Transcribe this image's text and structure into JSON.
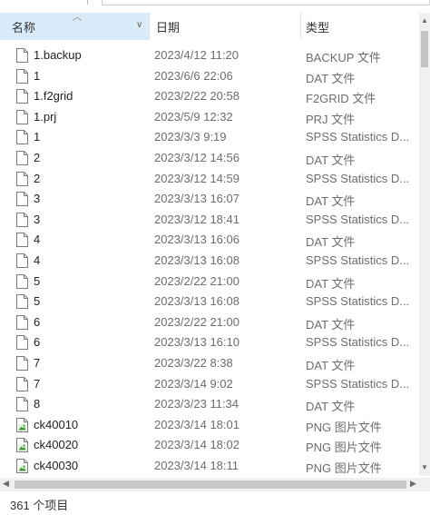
{
  "columns": {
    "name": "名称",
    "date": "日期",
    "type": "类型"
  },
  "sort": {
    "column": "name",
    "direction": "ascending"
  },
  "rows": [
    {
      "name": "1.backup",
      "date": "2023/4/12 11:20",
      "type": "BACKUP 文件",
      "icon": "generic-file-icon"
    },
    {
      "name": "1",
      "date": "2023/6/6 22:06",
      "type": "DAT 文件",
      "icon": "generic-file-icon"
    },
    {
      "name": "1.f2grid",
      "date": "2023/2/22 20:58",
      "type": "F2GRID 文件",
      "icon": "generic-file-icon"
    },
    {
      "name": "1.prj",
      "date": "2023/5/9 12:32",
      "type": "PRJ 文件",
      "icon": "generic-file-icon"
    },
    {
      "name": "1",
      "date": "2023/3/3 9:19",
      "type": "SPSS Statistics D...",
      "icon": "generic-file-icon"
    },
    {
      "name": "2",
      "date": "2023/3/12 14:56",
      "type": "DAT 文件",
      "icon": "generic-file-icon"
    },
    {
      "name": "2",
      "date": "2023/3/12 14:59",
      "type": "SPSS Statistics D...",
      "icon": "generic-file-icon"
    },
    {
      "name": "3",
      "date": "2023/3/13 16:07",
      "type": "DAT 文件",
      "icon": "generic-file-icon"
    },
    {
      "name": "3",
      "date": "2023/3/12 18:41",
      "type": "SPSS Statistics D...",
      "icon": "generic-file-icon"
    },
    {
      "name": "4",
      "date": "2023/3/13 16:06",
      "type": "DAT 文件",
      "icon": "generic-file-icon"
    },
    {
      "name": "4",
      "date": "2023/3/13 16:08",
      "type": "SPSS Statistics D...",
      "icon": "generic-file-icon"
    },
    {
      "name": "5",
      "date": "2023/2/22 21:00",
      "type": "DAT 文件",
      "icon": "generic-file-icon"
    },
    {
      "name": "5",
      "date": "2023/3/13 16:08",
      "type": "SPSS Statistics D...",
      "icon": "generic-file-icon"
    },
    {
      "name": "6",
      "date": "2023/2/22 21:00",
      "type": "DAT 文件",
      "icon": "generic-file-icon"
    },
    {
      "name": "6",
      "date": "2023/3/13 16:10",
      "type": "SPSS Statistics D...",
      "icon": "generic-file-icon"
    },
    {
      "name": "7",
      "date": "2023/3/22 8:38",
      "type": "DAT 文件",
      "icon": "generic-file-icon"
    },
    {
      "name": "7",
      "date": "2023/3/14 9:02",
      "type": "SPSS Statistics D...",
      "icon": "generic-file-icon"
    },
    {
      "name": "8",
      "date": "2023/3/23 11:34",
      "type": "DAT 文件",
      "icon": "generic-file-icon"
    },
    {
      "name": "ck40010",
      "date": "2023/3/14 18:01",
      "type": "PNG 图片文件",
      "icon": "image-file-icon"
    },
    {
      "name": "ck40020",
      "date": "2023/3/14 18:02",
      "type": "PNG 图片文件",
      "icon": "image-file-icon"
    },
    {
      "name": "ck40030",
      "date": "2023/3/14 18:11",
      "type": "PNG 图片文件",
      "icon": "image-file-icon"
    }
  ],
  "status": {
    "item_count": "361 个项目"
  },
  "colors": {
    "header_selected": "#d9ebf9",
    "meta_text": "#6d6d6d",
    "scroll_track": "#f0f0f0"
  }
}
